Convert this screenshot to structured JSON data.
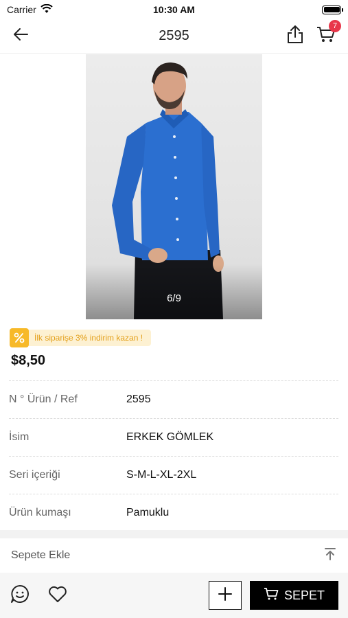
{
  "status_bar": {
    "carrier": "Carrier",
    "time": "10:30 AM"
  },
  "nav": {
    "title": "2595",
    "cart_count": "7"
  },
  "hero": {
    "counter": "6/9"
  },
  "promo": {
    "text": "İlk siparişe 3% indirim kazan !"
  },
  "price": "$8,50",
  "specs": [
    {
      "label": "N ° Ürün / Ref",
      "value": "2595"
    },
    {
      "label": "İsim",
      "value": "ERKEK GÖMLEK"
    },
    {
      "label": "Seri içeriği",
      "value": "S-M-L-XL-2XL"
    },
    {
      "label": "Ürün kumaşı",
      "value": "Pamuklu"
    }
  ],
  "add_section": {
    "label": "Sepete Ekle"
  },
  "bottom_bar": {
    "cart_button": "SEPET"
  },
  "colors": {
    "badge": "#e8364a",
    "promo_accent": "#f7b928",
    "promo_text": "#e3a01b",
    "shirt": "#2b6fd0",
    "button_dark": "#000000"
  },
  "icons": [
    "wifi-icon",
    "battery-icon",
    "back-arrow-icon",
    "share-icon",
    "cart-icon",
    "percent-icon",
    "scroll-top-icon",
    "chat-smile-icon",
    "heart-icon",
    "plus-icon",
    "cart-icon"
  ]
}
